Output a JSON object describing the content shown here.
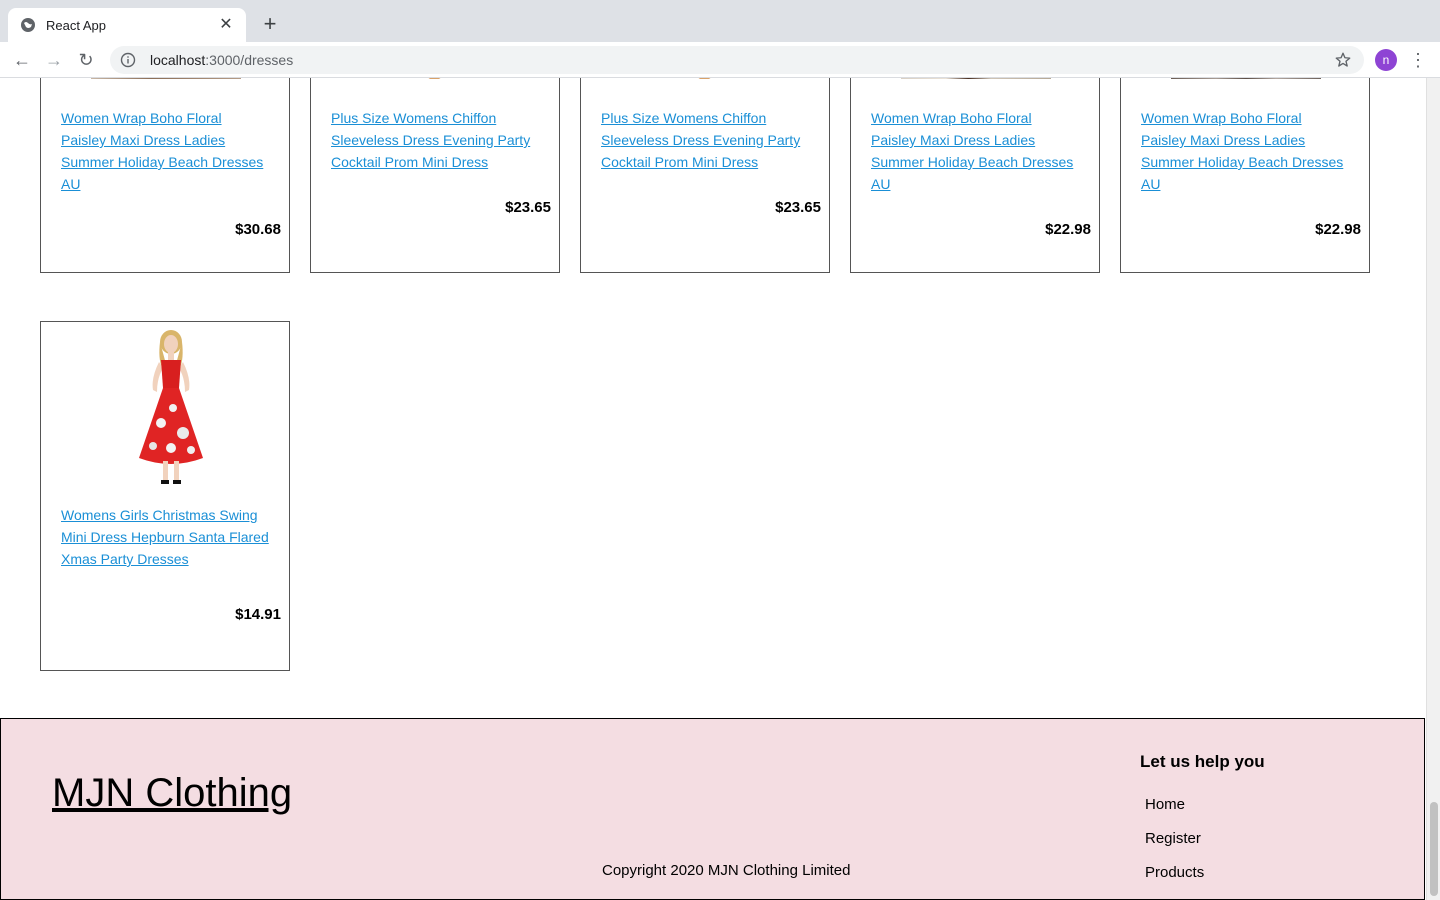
{
  "browser": {
    "tab_title": "React App",
    "url_host": "localhost",
    "url_path": ":3000/dresses",
    "profile_initial": "n"
  },
  "products_row1": [
    {
      "name": "Women Wrap Boho Floral Paisley Maxi Dress Ladies Summer Holiday Beach Dresses AU",
      "price": "$30.68"
    },
    {
      "name": "Plus Size Womens Chiffon Sleeveless Dress Evening Party Cocktail Prom Mini Dress",
      "price": "$23.65"
    },
    {
      "name": "Plus Size Womens Chiffon Sleeveless Dress Evening Party Cocktail Prom Mini Dress",
      "price": "$23.65"
    },
    {
      "name": "Women Wrap Boho Floral Paisley Maxi Dress Ladies Summer Holiday Beach Dresses AU",
      "price": "$22.98"
    },
    {
      "name": "Women Wrap Boho Floral Paisley Maxi Dress Ladies Summer Holiday Beach Dresses AU",
      "price": "$22.98"
    }
  ],
  "products_row2": [
    {
      "name": "Womens Girls Christmas Swing Mini Dress Hepburn Santa Flared Xmas Party Dresses",
      "price": "$14.91"
    }
  ],
  "footer": {
    "brand": "MJN Clothing",
    "copyright": "Copyright 2020 MJN Clothing Limited",
    "help_title": "Let us help you",
    "links": [
      "Home",
      "Register",
      "Products"
    ]
  },
  "colors": {
    "link": "#1a8fd6",
    "footer_bg": "#f4dde2",
    "avatar": "#8e44d4"
  }
}
